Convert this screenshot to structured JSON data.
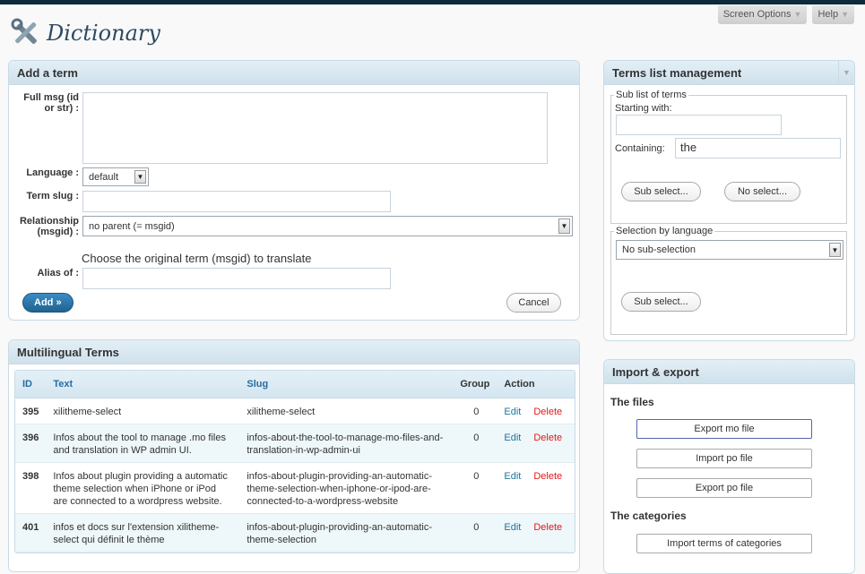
{
  "header": {
    "screen_options": "Screen Options",
    "help": "Help",
    "page_title": "Dictionary"
  },
  "add_term": {
    "title": "Add a term",
    "full_msg_label": "Full msg (id or str) :",
    "language_label": "Language :",
    "language_value": "default",
    "term_slug_label": "Term slug :",
    "relationship_label": "Relationship (msgid) :",
    "relationship_value": "no parent (= msgid)",
    "hint": "Choose the original term (msgid) to translate",
    "alias_label": "Alias of :",
    "add_button": "Add »",
    "cancel_button": "Cancel"
  },
  "multilingual": {
    "title": "Multilingual Terms",
    "columns": {
      "id": "ID",
      "text": "Text",
      "slug": "Slug",
      "group": "Group",
      "action": "Action"
    },
    "edit_label": "Edit",
    "delete_label": "Delete",
    "rows": [
      {
        "id": "395",
        "text": "xilitheme-select",
        "slug": "xilitheme-select",
        "group": "0"
      },
      {
        "id": "396",
        "text": "Infos about the tool to manage .mo files and translation in WP admin UI.",
        "slug": "infos-about-the-tool-to-manage-mo-files-and-translation-in-wp-admin-ui",
        "group": "0"
      },
      {
        "id": "398",
        "text": "Infos about plugin providing a automatic theme selection when iPhone or iPod are connected to a wordpress website.",
        "slug": "infos-about-plugin-providing-an-automatic-theme-selection-when-iphone-or-ipod-are-connected-to-a-wordpress-website",
        "group": "0"
      },
      {
        "id": "401",
        "text": "infos et docs sur l'extension xilitheme-select qui définit le thème",
        "slug": "infos-about-plugin-providing-an-automatic-theme-selection",
        "group": "0"
      }
    ]
  },
  "terms_list": {
    "title": "Terms list management",
    "sub_list_legend": "Sub list of terms",
    "starting_with_label": "Starting with:",
    "starting_with_value": "",
    "containing_label": "Containing:",
    "containing_value": "the",
    "sub_select_button": "Sub select...",
    "no_select_button": "No select...",
    "by_language_legend": "Selection by language",
    "language_select_value": "No sub-selection",
    "sub_select_button_2": "Sub select..."
  },
  "import_export": {
    "title": "Import & export",
    "files_heading": "The files",
    "export_mo": "Export mo file",
    "import_po": "Import po file",
    "export_po": "Export po file",
    "categories_heading": "The categories",
    "import_categories": "Import terms of categories"
  }
}
